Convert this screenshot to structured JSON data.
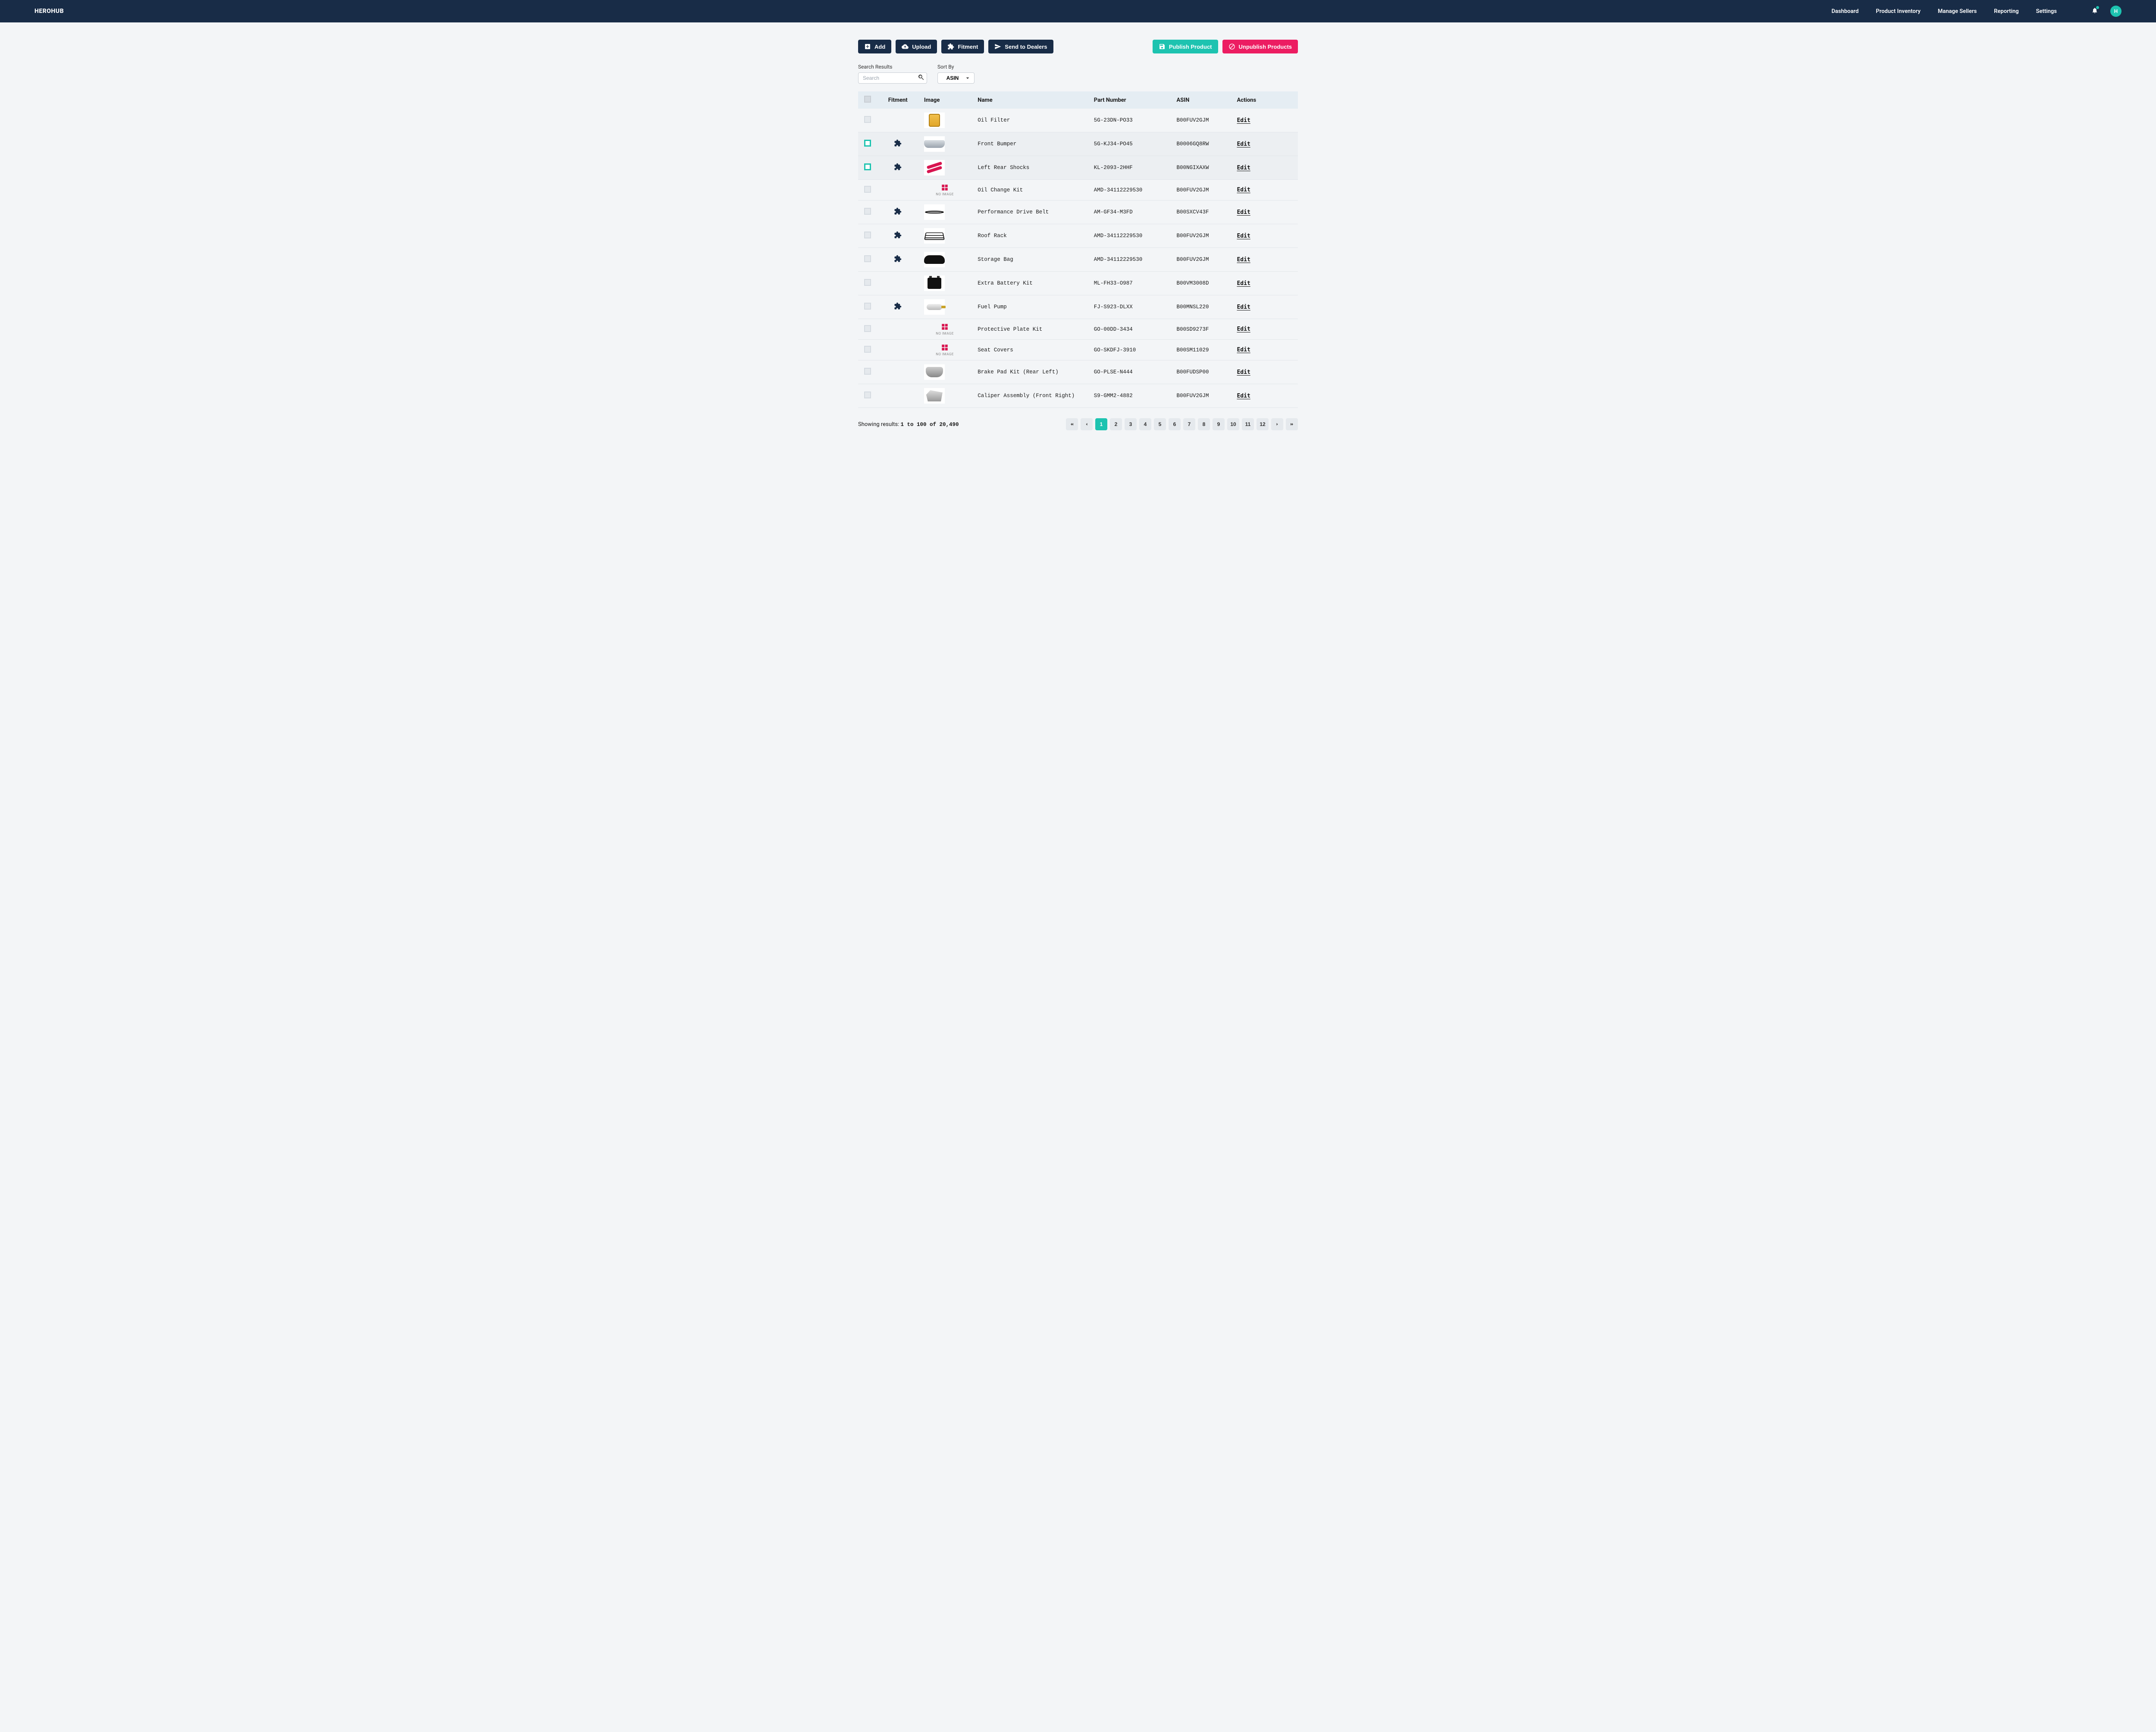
{
  "brand": "HEROHUB",
  "nav": {
    "dashboard": "Dashboard",
    "inventory": "Product Inventory",
    "sellers": "Manage Sellers",
    "reporting": "Reporting",
    "settings": "Settings"
  },
  "avatar_initial": "H",
  "toolbar": {
    "add": "Add",
    "upload": "Upload",
    "fitment": "Fitment",
    "send": "Send to Dealers",
    "publish": "Publish Product",
    "unpublish": "Unpublish Products"
  },
  "filters": {
    "search_label": "Search Results",
    "search_placeholder": "Search",
    "sort_label": "Sort By",
    "sort_value": "ASIN"
  },
  "columns": {
    "fitment": "Fitment",
    "image": "Image",
    "name": "Name",
    "part": "Part Number",
    "asin": "ASIN",
    "actions": "Actions"
  },
  "edit_label": "Edit",
  "no_image_label": "NO IMAGE",
  "rows": [
    {
      "selected": false,
      "fitment": false,
      "img": "oilfilter",
      "name": "Oil Filter",
      "part": "5G-23DN-PO33",
      "asin": "B00FUV2GJM"
    },
    {
      "selected": true,
      "fitment": true,
      "img": "bumper",
      "name": "Front Bumper",
      "part": "5G-KJ34-PO45",
      "asin": "B0006GQ8RW"
    },
    {
      "selected": true,
      "fitment": true,
      "img": "shocks",
      "name": "Left Rear Shocks",
      "part": "KL-2093-2HHF",
      "asin": "B00NGIXAXW"
    },
    {
      "selected": false,
      "fitment": false,
      "img": "noimage",
      "name": "Oil Change Kit",
      "part": "AMD-34112229530",
      "asin": "B00FUV2GJM"
    },
    {
      "selected": false,
      "fitment": true,
      "img": "belt",
      "name": "Performance Drive Belt",
      "part": "AM-GF34-M3FD",
      "asin": "B00SXCV43F"
    },
    {
      "selected": false,
      "fitment": true,
      "img": "rack",
      "name": "Roof Rack",
      "part": "AMD-34112229530",
      "asin": "B00FUV2GJM"
    },
    {
      "selected": false,
      "fitment": true,
      "img": "bag",
      "name": "Storage Bag",
      "part": "AMD-34112229530",
      "asin": "B00FUV2GJM"
    },
    {
      "selected": false,
      "fitment": false,
      "img": "battery",
      "name": "Extra Battery Kit",
      "part": "ML-FH33-O987",
      "asin": "B00VM3008D"
    },
    {
      "selected": false,
      "fitment": true,
      "img": "pump",
      "name": "Fuel Pump",
      "part": "FJ-S923-DLXX",
      "asin": "B00MNSL220"
    },
    {
      "selected": false,
      "fitment": false,
      "img": "noimage",
      "name": "Protective Plate Kit",
      "part": "GO-00DD-3434",
      "asin": "B00SD9273F"
    },
    {
      "selected": false,
      "fitment": false,
      "img": "noimage",
      "name": "Seat Covers",
      "part": "GO-SKDFJ-3910",
      "asin": "B00SM11029"
    },
    {
      "selected": false,
      "fitment": false,
      "img": "brake",
      "name": "Brake Pad Kit (Rear Left)",
      "part": "GO-PLSE-N444",
      "asin": "B00FUDSP00"
    },
    {
      "selected": false,
      "fitment": false,
      "img": "caliper",
      "name": "Caliper Assembly (Front Right)",
      "part": "S9-GMM2-4882",
      "asin": "B00FUV2GJM"
    }
  ],
  "footer": {
    "prefix": "Showing results:",
    "range": "1 to 100 of 20,490"
  },
  "pages": [
    "1",
    "2",
    "3",
    "4",
    "5",
    "6",
    "7",
    "8",
    "9",
    "10",
    "11",
    "12"
  ],
  "current_page": "1",
  "colors": {
    "navy": "#182c47",
    "teal": "#1dc3b0",
    "pink": "#ec1d62"
  }
}
